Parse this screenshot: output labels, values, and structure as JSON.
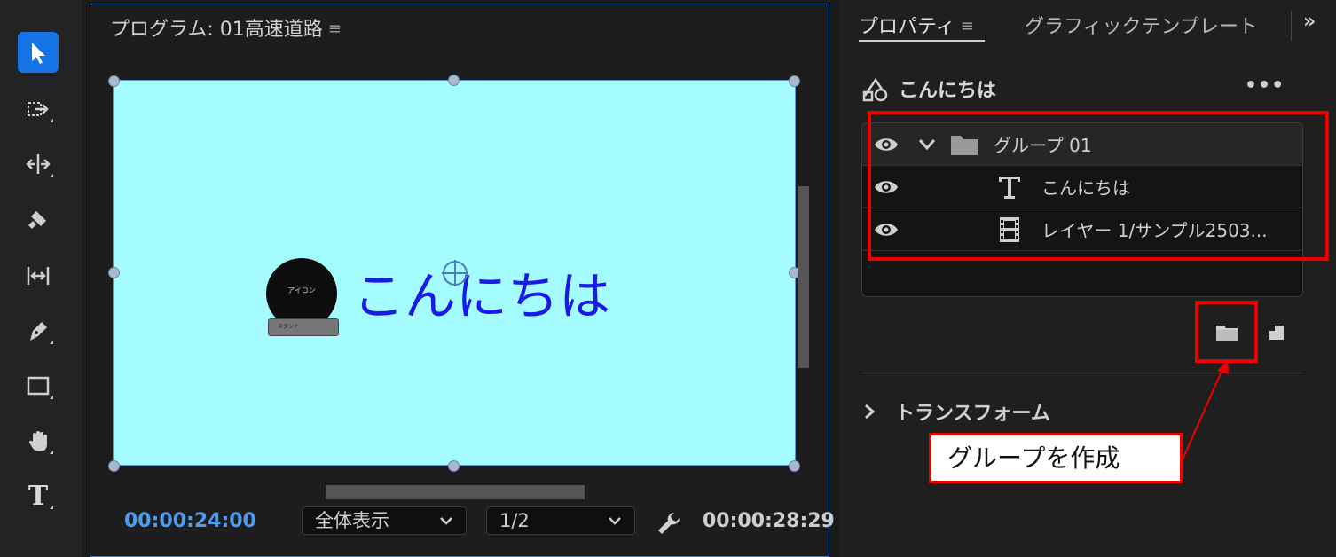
{
  "toolbar": {
    "tools": [
      {
        "icon": "selection-tool-icon",
        "active": true
      },
      {
        "icon": "track-select-forward-icon",
        "active": false
      },
      {
        "icon": "ripple-edit-icon",
        "active": false
      },
      {
        "icon": "razor-icon",
        "active": false
      },
      {
        "icon": "slip-tool-icon",
        "active": false
      },
      {
        "icon": "pen-tool-icon",
        "active": false
      },
      {
        "icon": "rectangle-tool-icon",
        "active": false
      },
      {
        "icon": "hand-tool-icon",
        "active": false
      },
      {
        "icon": "type-tool-icon",
        "active": false
      }
    ],
    "type_tool_label": "T",
    "accent": "#1473e6"
  },
  "monitor": {
    "title": "プログラム: 01高速道路",
    "menu_icon": "≡",
    "canvas_bg": "#a4fcff",
    "avatar_label": "アイコン",
    "stand_label": "スタンド",
    "canvas_text": "こんにちは",
    "timecode_current": "00:00:24:00",
    "zoom": "全体表示",
    "resolution": "1/2",
    "timecode_duration": "00:00:28:29"
  },
  "right_panel": {
    "tabs": [
      {
        "label": "プロパティ",
        "active": true
      },
      {
        "label": "グラフィックテンプレート",
        "active": false
      }
    ],
    "tab_menu_icon": "≡",
    "more_tabs": "»",
    "clip_title": "こんにちは",
    "more_options": "•••",
    "layers": [
      {
        "label": "グループ 01",
        "type": "group"
      },
      {
        "label": "こんにちは",
        "type": "text"
      },
      {
        "label": "レイヤー 1/サンプル2503...",
        "type": "video"
      }
    ],
    "section_transform": "トランスフォーム",
    "highlight_color": "#e00000"
  },
  "annotation": {
    "callout_text": "グループを作成"
  }
}
